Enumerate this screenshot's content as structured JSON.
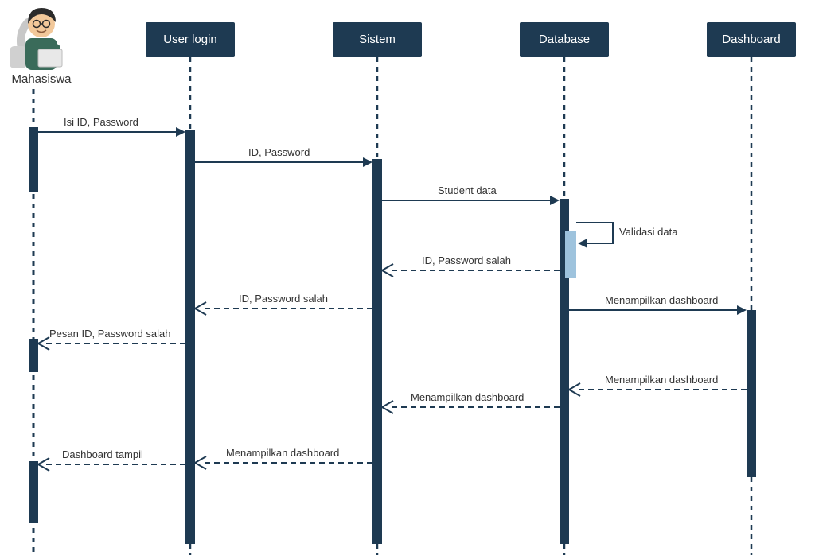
{
  "diagram_type": "UML Sequence Diagram",
  "colors": {
    "dark": "#1e3a52",
    "highlight": "#9ec3dd"
  },
  "actor": {
    "name": "Mahasiswa"
  },
  "participants": [
    {
      "id": "userlogin",
      "label": "User login"
    },
    {
      "id": "sistem",
      "label": "Sistem"
    },
    {
      "id": "database",
      "label": "Database"
    },
    {
      "id": "dashboard",
      "label": "Dashboard"
    }
  ],
  "messages": {
    "m1": "Isi ID, Password",
    "m2": "ID, Password",
    "m3": "Student data",
    "m4": "Validasi data",
    "m5": "ID, Password salah",
    "m6": "ID, Password salah",
    "m7": "Pesan ID, Password salah",
    "m8": "Menampilkan dashboard",
    "m9": "Menampilkan dashboard",
    "m10": "Menampilkan dashboard",
    "m11": "Menampilkan dashboard",
    "m12": "Dashboard tampil"
  }
}
